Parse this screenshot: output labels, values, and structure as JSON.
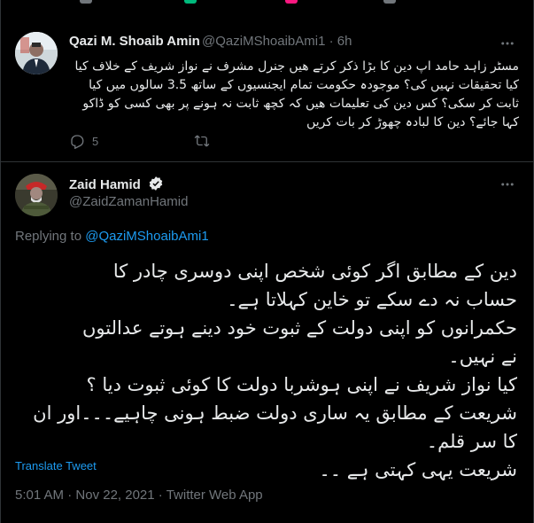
{
  "colors": {
    "background": "#000000",
    "text_primary": "#e7e9ea",
    "text_secondary": "#71767b",
    "accent": "#1d9bf0",
    "divider": "#2f3336"
  },
  "reply_tweet": {
    "author_name": "Qazi M. Shoaib Amin",
    "author_handle": "@QaziMShoaibAmi1",
    "separator": "·",
    "time_ago": "6h",
    "text": "مسٹر زاہد حامد اپ دین کا بڑا ذکر کرتے ھیں جنرل مشرف نے نواز شریف کے خلاف کیا کیا تحقیقات نہیں کی؟ موجودہ حکومت تمام ایجنسیوں کے ساتھ 3.5 سالوں میں کیا ثابت کر سکی؟ کس دین کی تعلیمات ھیں کہ کچھ ثابت نہ ہونے پر بھی کسی کو ڈاکو کہا جائے؟ دین کا لبادہ چھوڑ کر بات کریں",
    "reply_count": "5",
    "icons": [
      "more-icon",
      "reply-icon",
      "retweet-icon"
    ]
  },
  "main_tweet": {
    "author_name": "Zaid Hamid",
    "author_handle": "@ZaidZamanHamid",
    "verified": true,
    "replying_to_label": "Replying to",
    "replying_to_handle": "@QaziMShoaibAmi1",
    "text_lines": [
      "دین کے مطابق اگر کوئی شخص اپنی دوسری چادر کا",
      "حساب نہ دے سکے تو  خاین کہلاتا ہے۔",
      "حکمرانوں کو اپنی دولت کے ثبوت خود دینے ہوتے عدالتوں",
      "نے نہیں۔",
      "کیا نواز شریف نے اپنی ہوشربا دولت کا کوئی ثبوت دیا ؟",
      "شریعت کے مطابق یہ ساری دولت ضبط ہونی چاہیے۔۔۔اور ان",
      "کا سر قلم۔",
      "شریعت یہی کہتی ہے ۔۔"
    ],
    "translate_label": "Translate Tweet",
    "time": "5:01 AM",
    "separator": "·",
    "date": "Nov 22, 2021",
    "source": "Twitter Web App",
    "icons": [
      "verified-badge-icon",
      "more-icon"
    ]
  }
}
